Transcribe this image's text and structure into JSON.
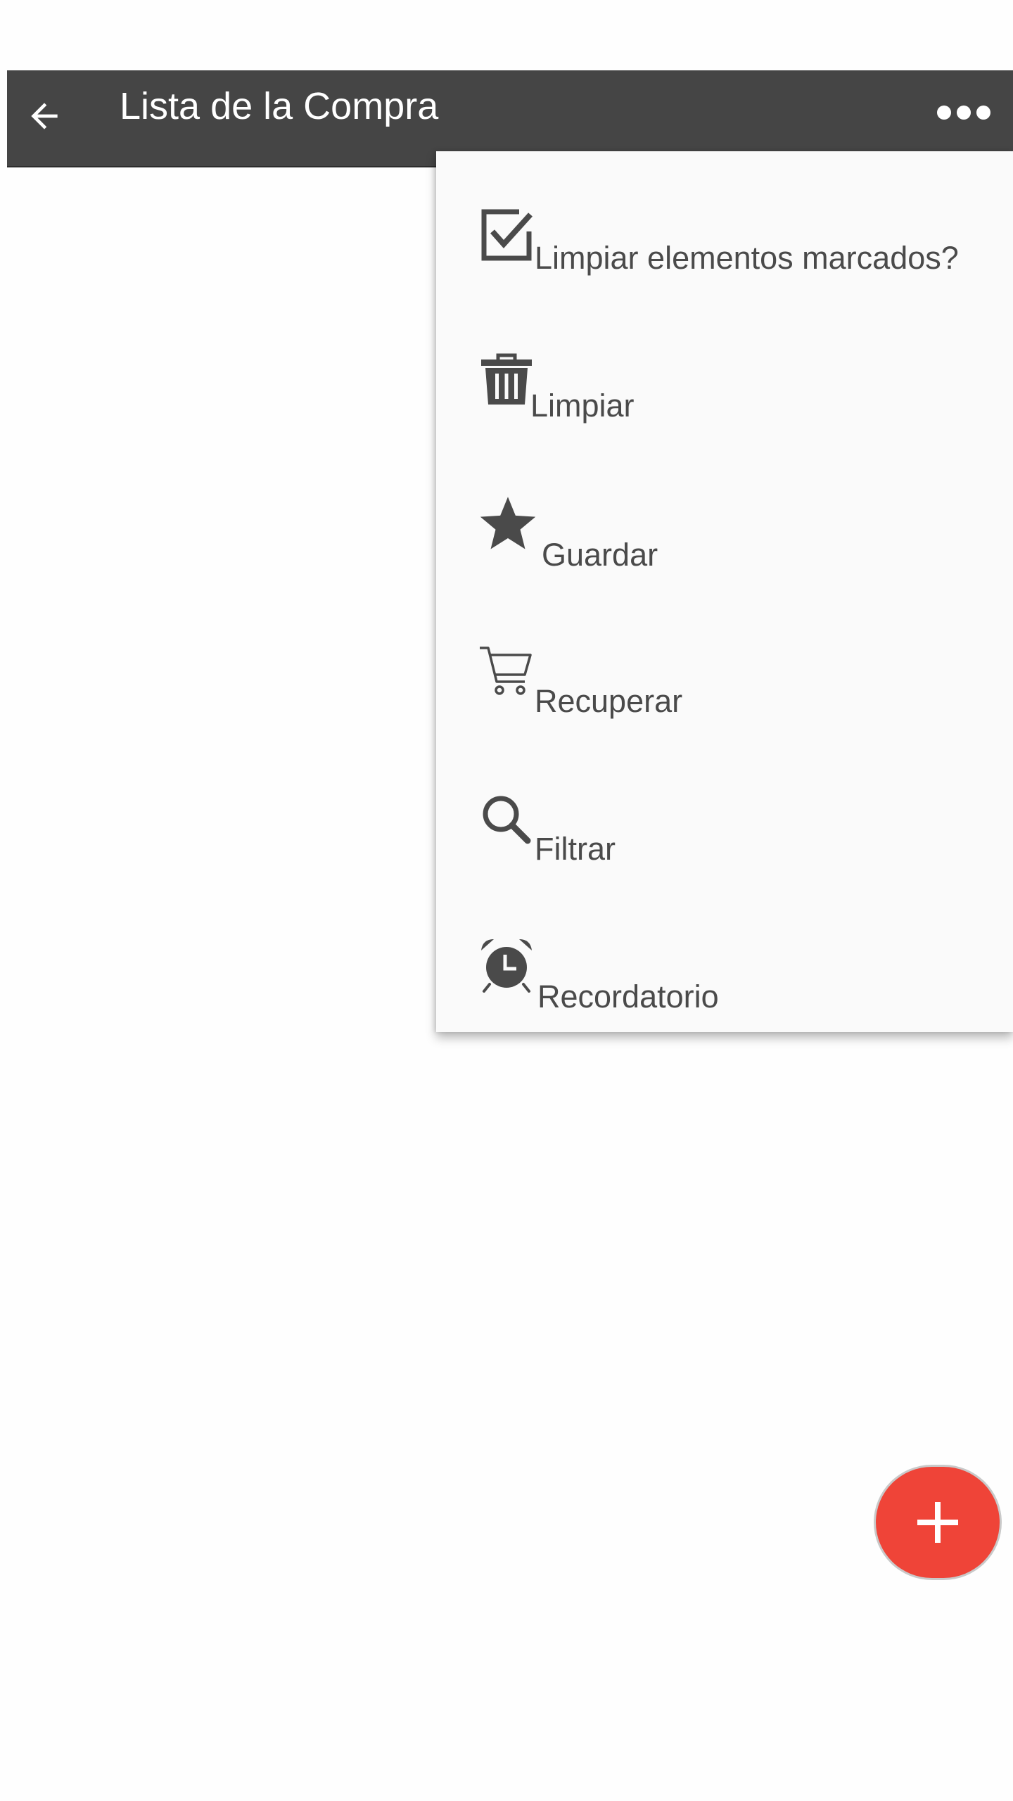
{
  "appbar": {
    "title": "Lista de la Compra",
    "back_icon": "arrow-left-icon",
    "overflow_icon": "more-horizontal-icon",
    "background": "#454545"
  },
  "menu": {
    "items": [
      {
        "label": "Limpiar elementos marcados?",
        "icon": "checkbox-checked-icon"
      },
      {
        "label": "Limpiar",
        "icon": "trash-icon"
      },
      {
        "label": "Guardar",
        "icon": "star-icon"
      },
      {
        "label": "Recuperar",
        "icon": "shopping-cart-icon"
      },
      {
        "label": "Filtrar",
        "icon": "search-icon"
      },
      {
        "label": "Recordatorio",
        "icon": "alarm-clock-icon"
      }
    ]
  },
  "fab": {
    "icon": "plus-icon",
    "color": "#ef4438"
  }
}
